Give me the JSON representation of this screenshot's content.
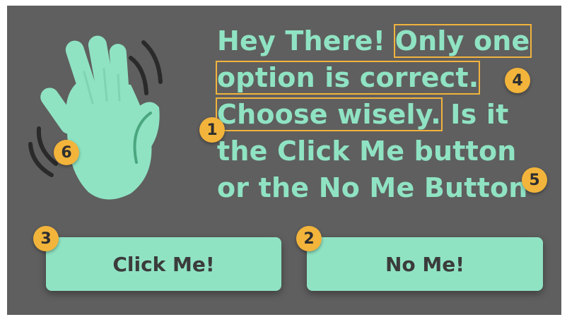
{
  "message": {
    "seg1": "Hey There! ",
    "seg2": "Only one",
    "seg3": "option is correct.",
    "seg4": "Choose wisely.",
    "seg5": " Is it",
    "seg6": "the Click Me button",
    "seg7": "or the No Me Button"
  },
  "buttons": {
    "click_me": "Click Me!",
    "no_me": "No Me!"
  },
  "badges": [
    "1",
    "2",
    "3",
    "4",
    "5",
    "6"
  ],
  "colors": {
    "panel_background": "#5f5f5f",
    "accent_mint": "#8fe3c3",
    "badge_yellow": "#f3b43b",
    "button_text": "#3b3b3b"
  },
  "icons": {
    "hand": "waving-hand-icon"
  }
}
